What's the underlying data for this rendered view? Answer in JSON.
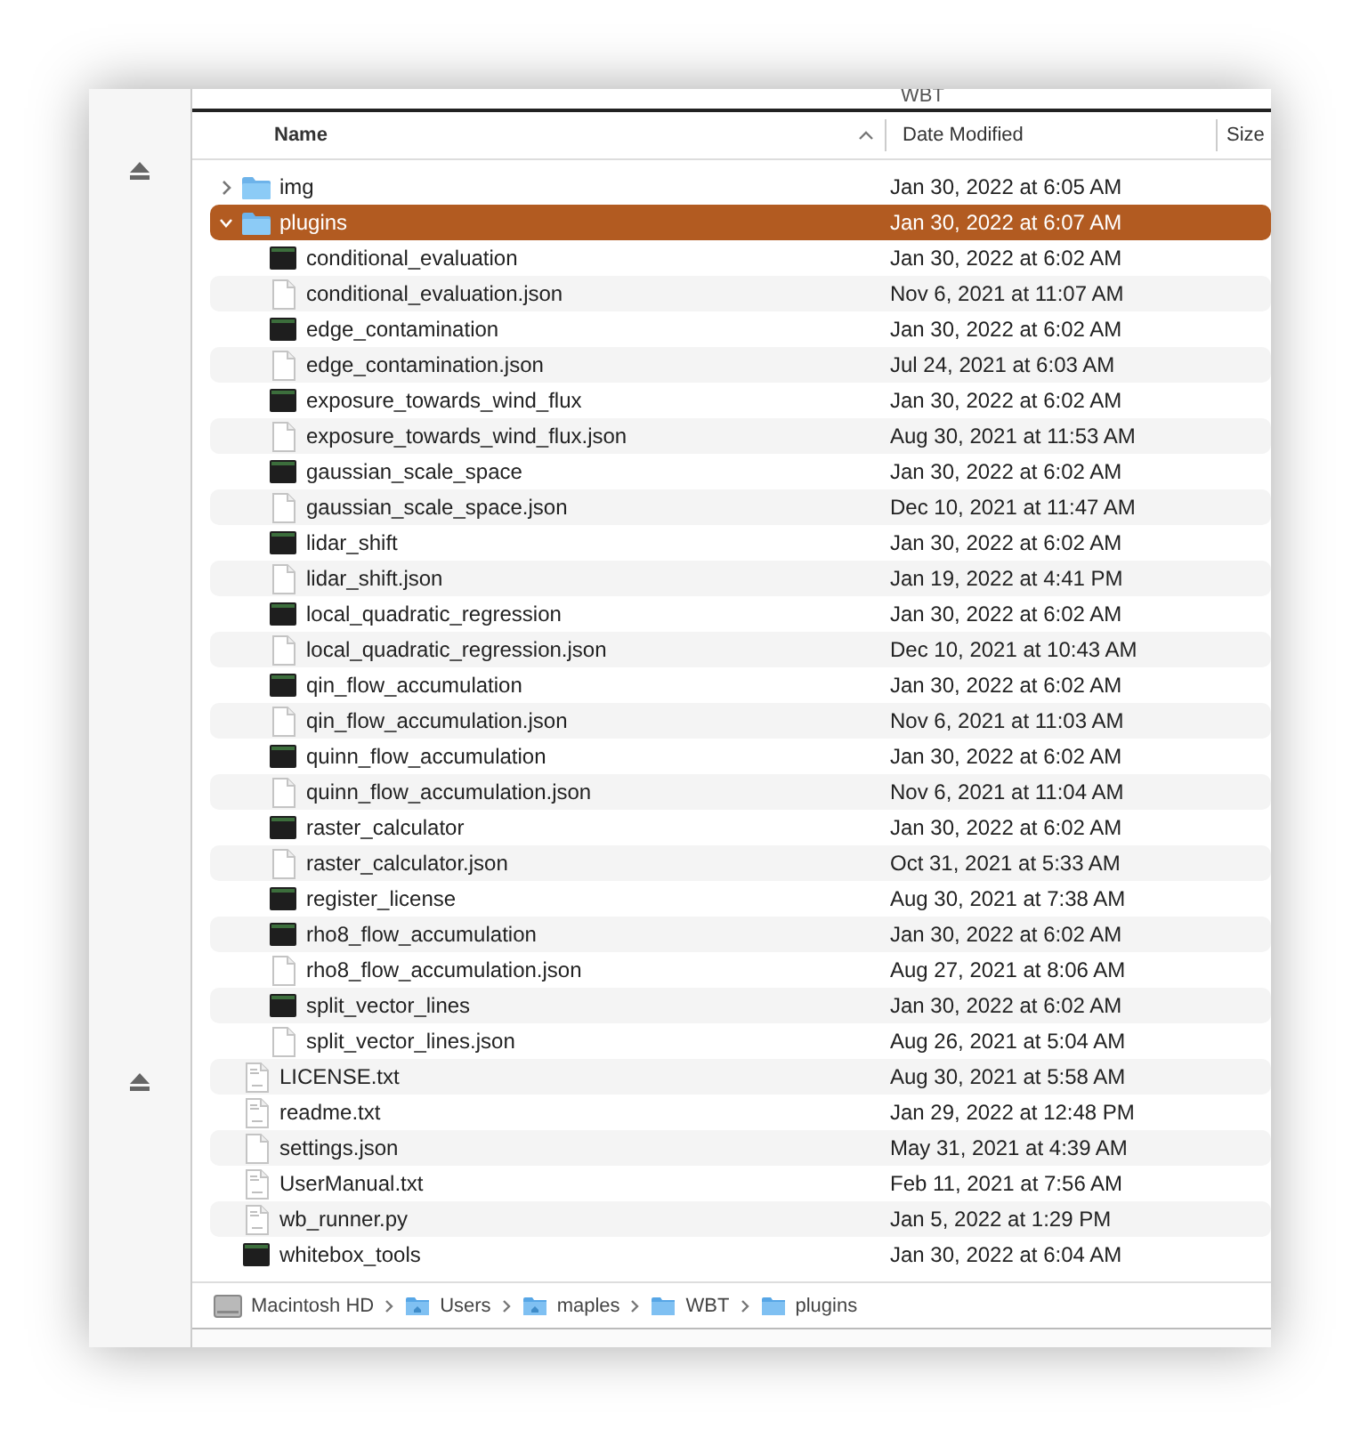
{
  "window": {
    "title": "WBT"
  },
  "sidebar": {
    "items": [
      {
        "kind": "eject"
      },
      {
        "kind": "eject"
      }
    ]
  },
  "table": {
    "columns": [
      {
        "label": "Name",
        "sorted": true
      },
      {
        "label": "Date Modified",
        "sorted": false
      },
      {
        "label": "Size",
        "sorted": false
      }
    ],
    "rows": [
      {
        "name": "img",
        "kind": "folder",
        "expanded": false,
        "selected": false,
        "date": "Jan 30, 2022 at 6:05 AM"
      },
      {
        "name": "plugins",
        "kind": "folder",
        "expanded": true,
        "selected": true,
        "date": "Jan 30, 2022 at 6:07 AM",
        "children": [
          {
            "name": "conditional_evaluation",
            "kind": "exec",
            "selected": false,
            "date": "Jan 30, 2022 at 6:02 AM"
          },
          {
            "name": "conditional_evaluation.json",
            "kind": "doc",
            "selected": false,
            "date": "Nov 6, 2021 at 11:07 AM"
          },
          {
            "name": "edge_contamination",
            "kind": "exec",
            "selected": false,
            "date": "Jan 30, 2022 at 6:02 AM"
          },
          {
            "name": "edge_contamination.json",
            "kind": "doc",
            "selected": false,
            "date": "Jul 24, 2021 at 6:03 AM"
          },
          {
            "name": "exposure_towards_wind_flux",
            "kind": "exec",
            "selected": false,
            "date": "Jan 30, 2022 at 6:02 AM"
          },
          {
            "name": "exposure_towards_wind_flux.json",
            "kind": "doc",
            "selected": false,
            "date": "Aug 30, 2021 at 11:53 AM"
          },
          {
            "name": "gaussian_scale_space",
            "kind": "exec",
            "selected": false,
            "date": "Jan 30, 2022 at 6:02 AM"
          },
          {
            "name": "gaussian_scale_space.json",
            "kind": "doc",
            "selected": false,
            "date": "Dec 10, 2021 at 11:47 AM"
          },
          {
            "name": "lidar_shift",
            "kind": "exec",
            "selected": false,
            "date": "Jan 30, 2022 at 6:02 AM"
          },
          {
            "name": "lidar_shift.json",
            "kind": "doc",
            "selected": false,
            "date": "Jan 19, 2022 at 4:41 PM"
          },
          {
            "name": "local_quadratic_regression",
            "kind": "exec",
            "selected": false,
            "date": "Jan 30, 2022 at 6:02 AM"
          },
          {
            "name": "local_quadratic_regression.json",
            "kind": "doc",
            "selected": false,
            "date": "Dec 10, 2021 at 10:43 AM"
          },
          {
            "name": "qin_flow_accumulation",
            "kind": "exec",
            "selected": false,
            "date": "Jan 30, 2022 at 6:02 AM"
          },
          {
            "name": "qin_flow_accumulation.json",
            "kind": "doc",
            "selected": false,
            "date": "Nov 6, 2021 at 11:03 AM"
          },
          {
            "name": "quinn_flow_accumulation",
            "kind": "exec",
            "selected": false,
            "date": "Jan 30, 2022 at 6:02 AM"
          },
          {
            "name": "quinn_flow_accumulation.json",
            "kind": "doc",
            "selected": false,
            "date": "Nov 6, 2021 at 11:04 AM"
          },
          {
            "name": "raster_calculator",
            "kind": "exec",
            "selected": false,
            "date": "Jan 30, 2022 at 6:02 AM"
          },
          {
            "name": "raster_calculator.json",
            "kind": "doc",
            "selected": false,
            "date": "Oct 31, 2021 at 5:33 AM"
          },
          {
            "name": "register_license",
            "kind": "exec",
            "selected": false,
            "date": "Aug 30, 2021 at 7:38 AM"
          },
          {
            "name": "rho8_flow_accumulation",
            "kind": "exec",
            "selected": false,
            "date": "Jan 30, 2022 at 6:02 AM"
          },
          {
            "name": "rho8_flow_accumulation.json",
            "kind": "doc",
            "selected": false,
            "date": "Aug 27, 2021 at 8:06 AM"
          },
          {
            "name": "split_vector_lines",
            "kind": "exec",
            "selected": false,
            "date": "Jan 30, 2022 at 6:02 AM"
          },
          {
            "name": "split_vector_lines.json",
            "kind": "doc",
            "selected": false,
            "date": "Aug 26, 2021 at 5:04 AM"
          }
        ]
      },
      {
        "name": "LICENSE.txt",
        "kind": "txt",
        "selected": false,
        "date": "Aug 30, 2021 at 5:58 AM"
      },
      {
        "name": "readme.txt",
        "kind": "txt",
        "selected": false,
        "date": "Jan 29, 2022 at 12:48 PM"
      },
      {
        "name": "settings.json",
        "kind": "doc",
        "selected": false,
        "date": "May 31, 2021 at 4:39 AM"
      },
      {
        "name": "UserManual.txt",
        "kind": "txt",
        "selected": false,
        "date": "Feb 11, 2021 at 7:56 AM"
      },
      {
        "name": "wb_runner.py",
        "kind": "txt",
        "selected": false,
        "date": "Jan 5, 2022 at 1:29 PM"
      },
      {
        "name": "whitebox_tools",
        "kind": "exec",
        "selected": false,
        "date": "Jan 30, 2022 at 6:04 AM"
      }
    ]
  },
  "path_bar": [
    {
      "label": "Macintosh HD",
      "kind": "disk"
    },
    {
      "label": "Users",
      "kind": "home-folder"
    },
    {
      "label": "maples",
      "kind": "home-folder"
    },
    {
      "label": "WBT",
      "kind": "folder"
    },
    {
      "label": "plugins",
      "kind": "folder"
    }
  ]
}
